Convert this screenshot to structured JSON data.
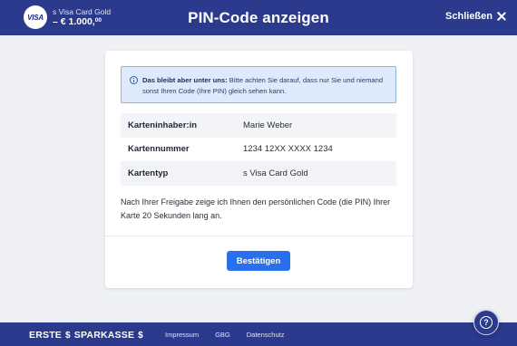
{
  "header": {
    "card_brand": "VISA",
    "card_name": "s Visa Card Gold",
    "balance_main": "– € 1.000,",
    "balance_cents": "00",
    "title": "PIN-Code anzeigen",
    "close_label": "Schließen"
  },
  "notice": {
    "strong": "Das bleibt aber unter uns:",
    "text": " Bitte achten Sie darauf, dass nur Sie und niemand sonst Ihren Code (Ihre PIN) gleich sehen kann."
  },
  "details": [
    {
      "label": "Karteninhaber:in",
      "value": "Marie Weber"
    },
    {
      "label": "Kartennummer",
      "value": "1234 12XX XXXX 1234"
    },
    {
      "label": "Kartentyp",
      "value": "s Visa Card Gold"
    }
  ],
  "explanation": "Nach Ihrer Freigabe zeige ich Ihnen den persönlichen Code (die PIN) Ihrer Karte 20 Sekunden lang an.",
  "confirm_label": "Bestätigen",
  "footer": {
    "brand_left": "ERSTE",
    "brand_right": "SPARKASSE",
    "logo_glyph": "$",
    "links": [
      "Impressum",
      "GBG",
      "Datenschutz"
    ]
  },
  "help_label": "?",
  "icons": {
    "close": "close-icon",
    "info": "info-icon",
    "help": "help-icon"
  },
  "colors": {
    "brand_navy": "#2b3a8c",
    "primary_button": "#2870ed",
    "notice_bg": "#dceafc"
  }
}
